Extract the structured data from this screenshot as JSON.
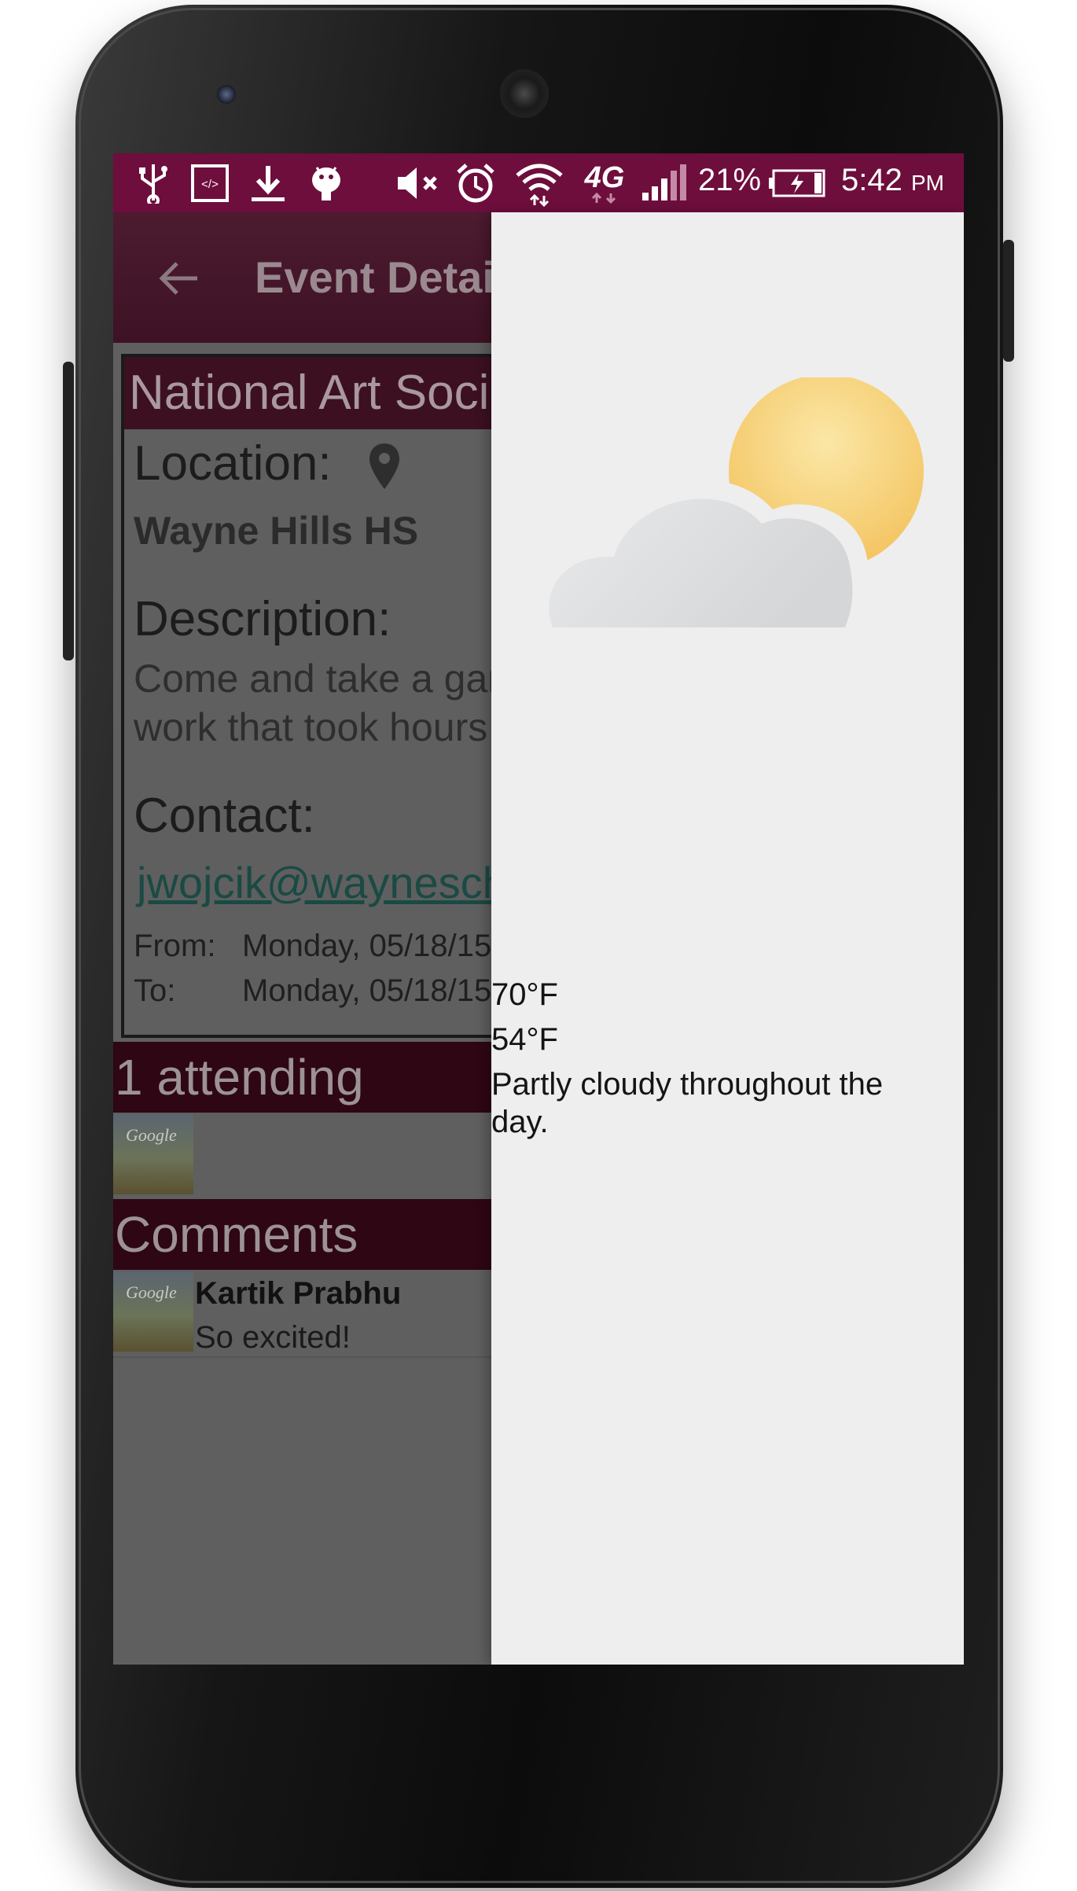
{
  "status_bar": {
    "icons": [
      "usb-icon",
      "developer-icon",
      "download-icon",
      "android-icon",
      "mute-icon",
      "alarm-icon",
      "wifi-icon",
      "network-4g-icon",
      "signal-icon",
      "battery-charging-icon"
    ],
    "network_type": "4G",
    "battery_percent": "21%",
    "time": "5:42",
    "time_suffix": "PM",
    "background_color": "#6e0e3c"
  },
  "app_bar": {
    "title": "Event Details",
    "back_icon": "arrow-left-icon"
  },
  "event": {
    "name": "National Art Society",
    "location_label": "Location:",
    "location_icon": "map-pin-icon",
    "location_value": "Wayne Hills HS",
    "description_label": "Description:",
    "description_lines": [
      "Come and take a gander at the",
      "work that took hours to create"
    ],
    "contact_label": "Contact:",
    "contact_email": "jwojcik@wayneschools.com",
    "from_label": "From:",
    "from_value": "Monday, 05/18/15",
    "to_label": "To:",
    "to_value": "Monday, 05/18/15"
  },
  "attending": {
    "header": "1 attending"
  },
  "comments": {
    "header": "Comments",
    "items": [
      {
        "author": "Kartik Prabhu",
        "text": "So excited!",
        "thumb_text": "Google"
      }
    ]
  },
  "weather": {
    "icon": "partly-cloudy-icon",
    "high": "70°F",
    "low": "54°F",
    "summary_line1": "Partly cloudy throughout the",
    "summary_line2": "day."
  },
  "colors": {
    "accent": "#6e0e3c",
    "section_header": "#2e0614",
    "drawer_bg": "#eeeeee"
  }
}
